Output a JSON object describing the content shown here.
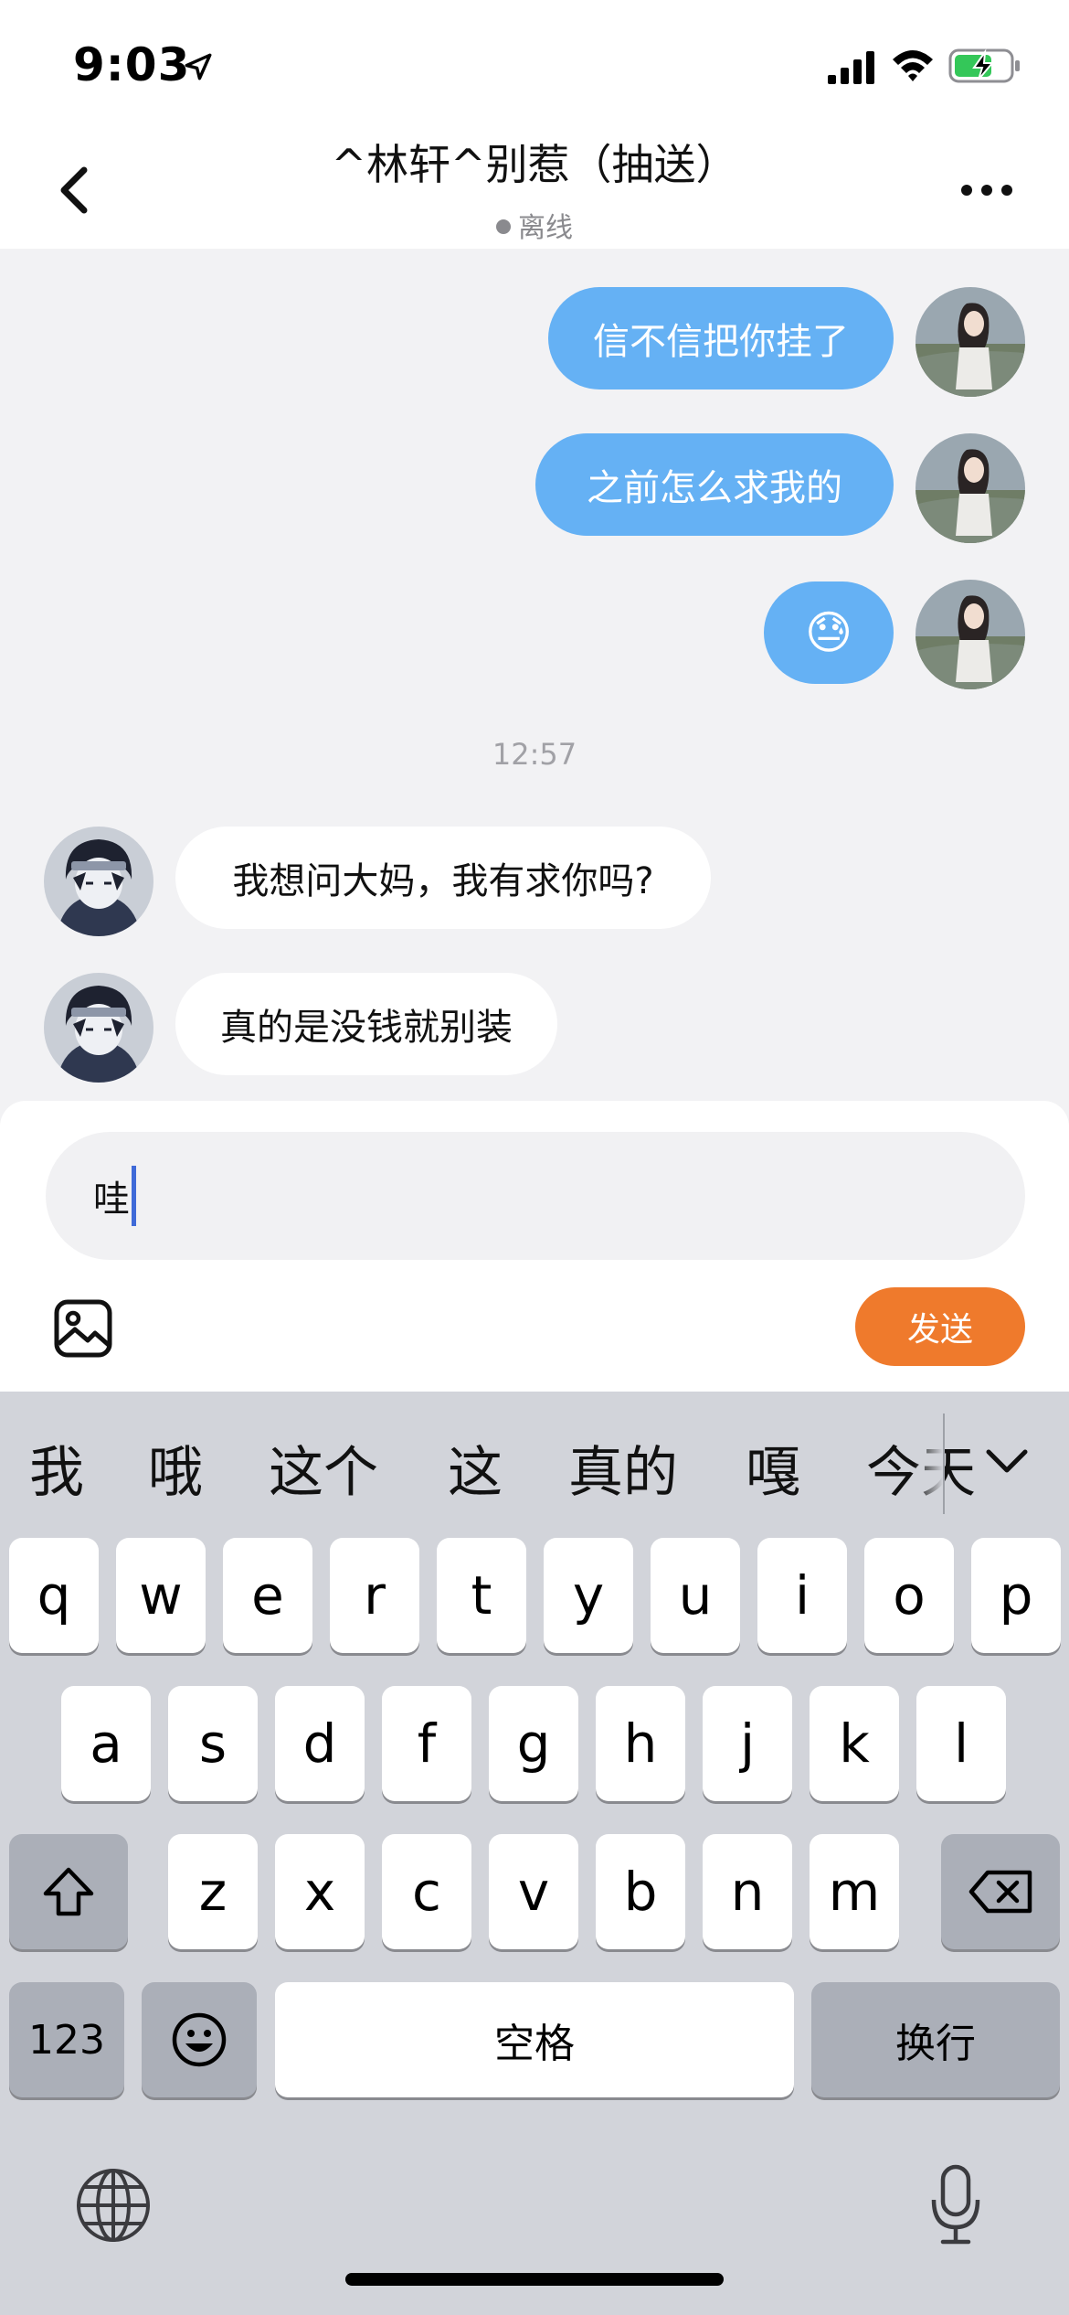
{
  "status_bar": {
    "time": "9:03"
  },
  "header": {
    "title": "^林轩^别惹（抽送）",
    "status": "离线"
  },
  "messages": [
    {
      "side": "out",
      "text": "信不信把你挂了"
    },
    {
      "side": "out",
      "text": "之前怎么求我的"
    },
    {
      "side": "out",
      "text": "😓"
    },
    {
      "side": "in",
      "text": "我想问大妈，我有求你吗?"
    },
    {
      "side": "in",
      "text": "真的是没钱就别装"
    }
  ],
  "timestamp": "12:57",
  "composer": {
    "input_value": "哇",
    "send_label": "发送"
  },
  "keyboard": {
    "candidates": [
      "我",
      "哦",
      "这个",
      "这",
      "真的",
      "嘎",
      "今天"
    ],
    "row1": [
      "q",
      "w",
      "e",
      "r",
      "t",
      "y",
      "u",
      "i",
      "o",
      "p"
    ],
    "row2": [
      "a",
      "s",
      "d",
      "f",
      "g",
      "h",
      "j",
      "k",
      "l"
    ],
    "row3": [
      "z",
      "x",
      "c",
      "v",
      "b",
      "n",
      "m"
    ],
    "numbers_label": "123",
    "space_label": "空格",
    "return_label": "换行"
  },
  "colors": {
    "outgoing_bubble": "#65b1f4",
    "send_button": "#ef7a2c",
    "caret": "#3f6ad8"
  }
}
